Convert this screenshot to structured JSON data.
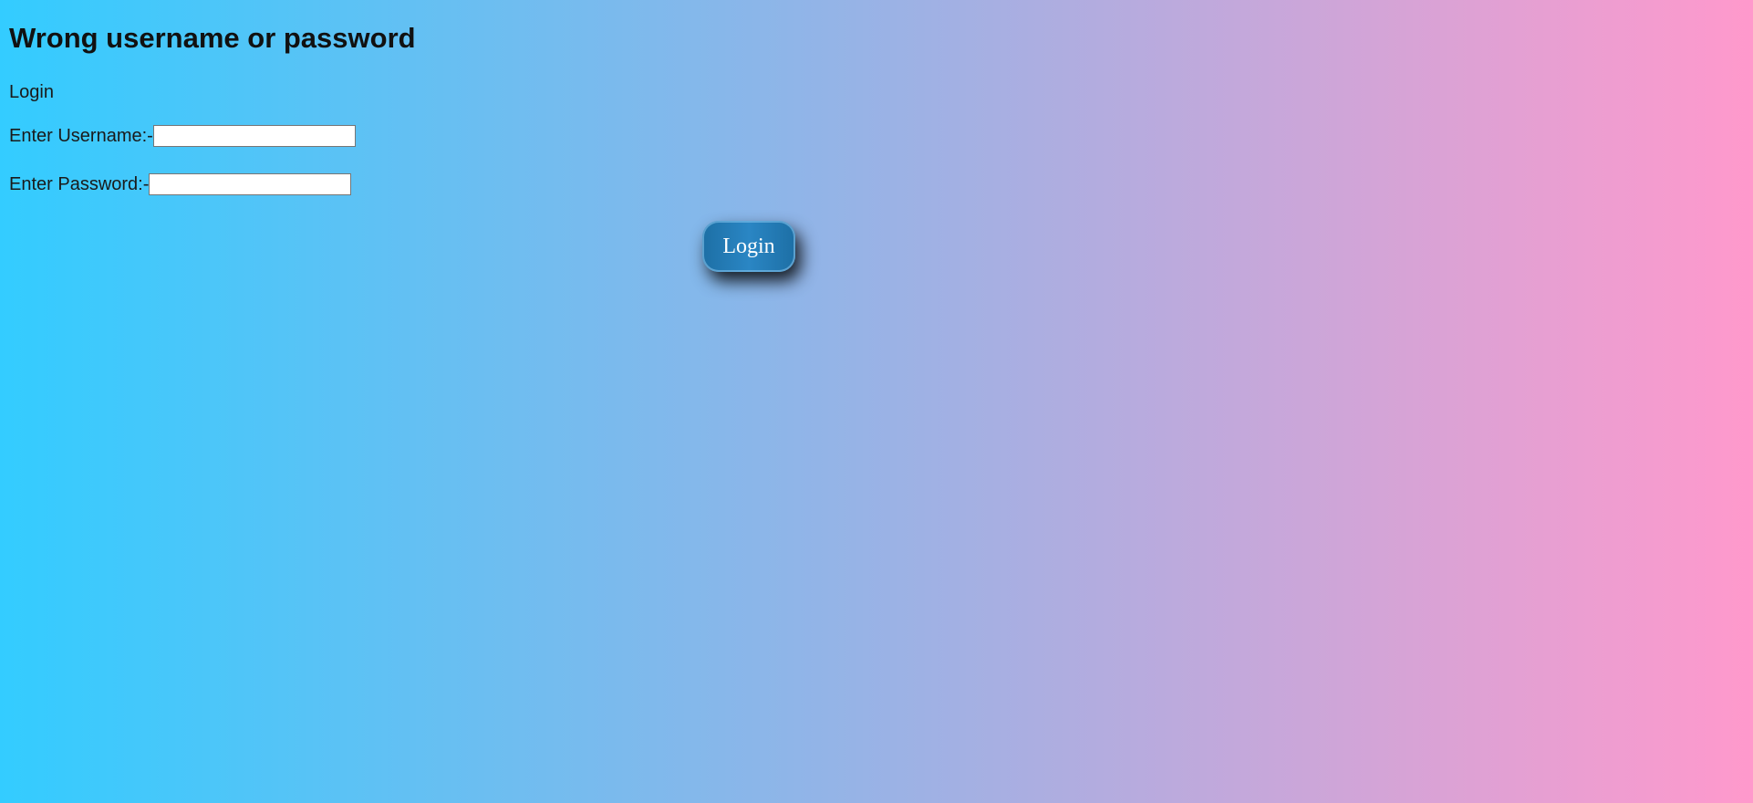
{
  "error": {
    "heading": "Wrong username or password"
  },
  "form": {
    "caption": "Login",
    "username_label": "Enter Username:-",
    "username_value": "",
    "password_label": "Enter Password:-",
    "password_value": "",
    "submit_label": "Login"
  },
  "colors": {
    "gradient_start": "#33ccff",
    "gradient_end": "#ff99cc",
    "button": "#2a86c4"
  }
}
